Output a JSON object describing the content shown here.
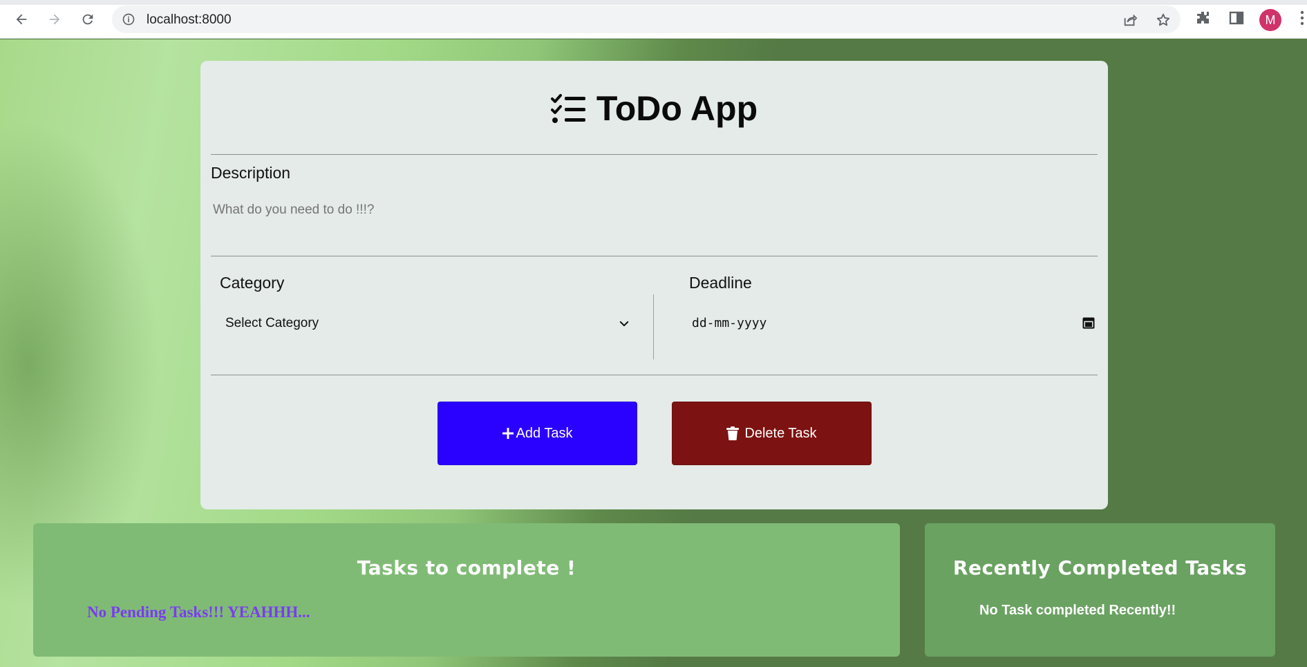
{
  "browser": {
    "url": "localhost:8000",
    "avatar_letter": "M",
    "icons": [
      "back-icon",
      "forward-icon",
      "reload-icon",
      "site-info-icon",
      "share-icon",
      "bookmark-star-icon",
      "extensions-icon",
      "side-panel-icon",
      "more-menu-icon"
    ]
  },
  "app": {
    "title": "ToDo App",
    "title_icon": "checklist-icon",
    "description_label": "Description",
    "description_placeholder": "What do you need to do !!!?",
    "category_label": "Category",
    "category_selected": "Select Category",
    "deadline_label": "Deadline",
    "deadline_placeholder": "dd-mm-yyyy",
    "add_button": "Add Task",
    "delete_button": "Delete Task"
  },
  "pending": {
    "title": "Tasks to complete !",
    "empty_message": "No Pending Tasks!!! YEAHHH..."
  },
  "completed": {
    "title": "Recently Completed Tasks",
    "empty_message": "No Task completed Recently!!"
  },
  "colors": {
    "add_button": "#2a00ff",
    "delete_button": "#7d1212",
    "card_bg": "#e4ebe8",
    "pending_panel": "#80bb76",
    "completed_panel": "#6aa261",
    "pending_message": "#7a3cf0"
  }
}
